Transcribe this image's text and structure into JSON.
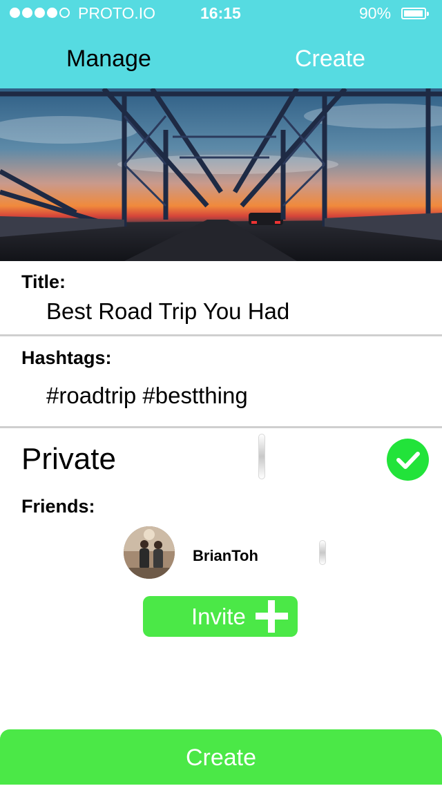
{
  "status_bar": {
    "carrier": "PROTO.IO",
    "time": "16:15",
    "battery": "90%",
    "signal_bars_filled": 4,
    "signal_bars_total": 5
  },
  "nav": {
    "manage_label": "Manage",
    "create_label": "Create"
  },
  "form": {
    "title_label": "Title:",
    "title_value": "Best Road Trip You Had",
    "hashtags_label": "Hashtags:",
    "hashtags_value": "#roadtrip #bestthing",
    "private_label": "Private",
    "private_checked": true,
    "friends_label": "Friends:"
  },
  "friends": [
    {
      "name": "BrianToh"
    }
  ],
  "invite_label": "Invite",
  "create_button_label": "Create",
  "colors": {
    "header": "#56dbe1",
    "button_green": "#4be847",
    "check_green": "#22e33a",
    "divider": "#cfcfcf"
  },
  "icons": [
    "check-icon",
    "plus-icon",
    "battery-icon",
    "signal-icon"
  ]
}
